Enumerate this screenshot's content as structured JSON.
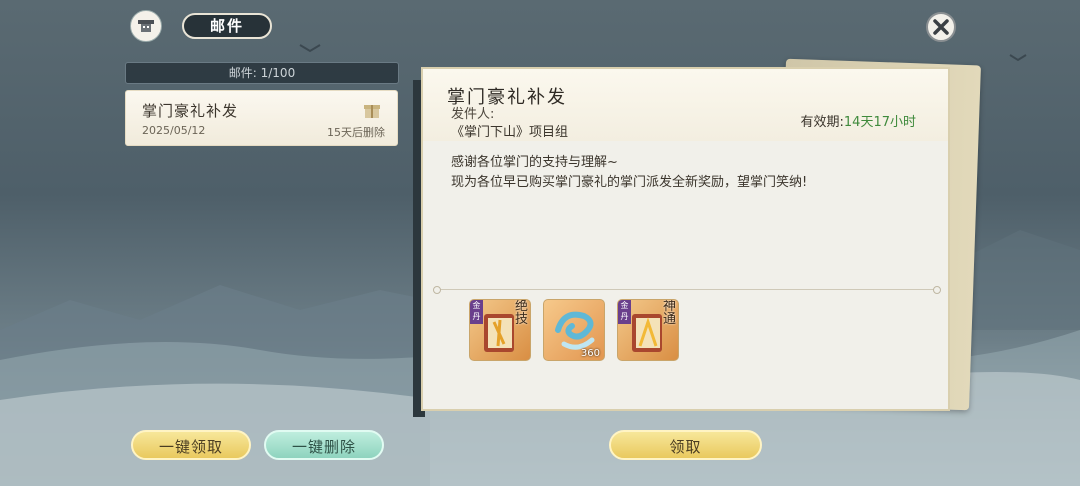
{
  "header": {
    "title": "邮件",
    "avatar_icon": "helmet-icon",
    "close_icon": "close-icon"
  },
  "mail_list": {
    "count_text": "邮件: 1/100",
    "items": [
      {
        "subject": "掌门豪礼补发",
        "date": "2025/05/12",
        "expire": "15天后删除",
        "icon": "gift-icon"
      }
    ]
  },
  "detail": {
    "title": "掌门豪礼补发",
    "sender_label": "发件人:",
    "sender": "《掌门下山》项目组",
    "validity_label": "有效期:",
    "validity_value": "14天17小时",
    "body_line1": "感谢各位掌门的支持与理解~",
    "body_line2": "现为各位早已购买掌门豪礼的掌门派发全新奖励，望掌门笑纳!",
    "rewards": [
      {
        "name": "book-item",
        "tag": "金丹",
        "chars": "绝技",
        "qty": ""
      },
      {
        "name": "wind-item",
        "tag": "",
        "chars": "",
        "qty": "360"
      },
      {
        "name": "book-item",
        "tag": "金丹",
        "chars": "神通",
        "qty": ""
      }
    ]
  },
  "buttons": {
    "claim_all": "一键领取",
    "delete_all": "一键删除",
    "claim": "领取"
  },
  "colors": {
    "validity_green": "#3f8a3c",
    "button_yellow": "#f1d978",
    "button_green": "#a8e2cf"
  }
}
